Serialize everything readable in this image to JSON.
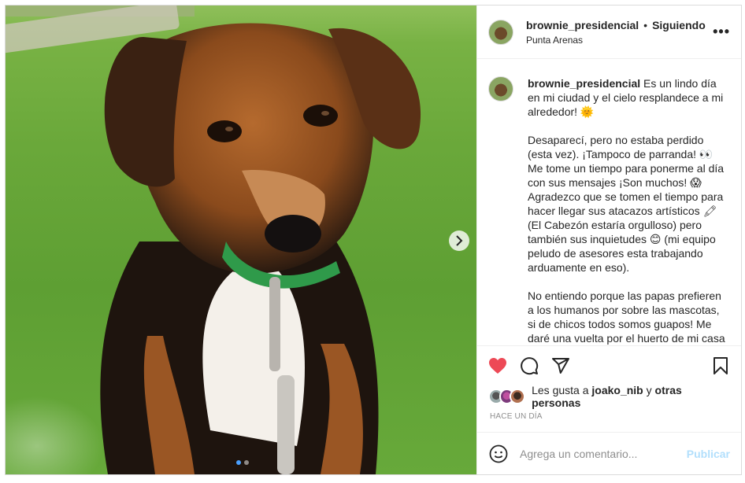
{
  "post": {
    "username": "brownie_presidencial",
    "follow_status": "Siguiendo",
    "separator": "•",
    "location": "Punta Arenas",
    "more_glyph": "•••"
  },
  "caption": {
    "username": "brownie_presidencial",
    "text": " Es un lindo día en mi ciudad y el cielo resplandece a mi alrededor! 🌞\n\nDesaparecí, pero no estaba perdido (esta vez). ¡Tampoco de parranda! 👀 Me tome un tiempo para ponerme al día con sus mensajes ¡Son muchos! 😱 Agradezco que se tomen el tiempo para hacer llegar sus atacazos artísticos 🖍 (El Cabezón estaría orgulloso) pero también sus inquietudes 😊 (mi equipo peludo de asesores esta trabajando arduamente en eso).\n\nNo entiendo porque las papas prefieren a los humanos por sobre las mascotas, si de chicos todos somos guapos! Me daré una vuelta por el huerto de mi casa para"
  },
  "likes": {
    "prefix": "Les gusta a ",
    "user": "joako_nib",
    "middle": " y ",
    "others": "otras personas"
  },
  "timestamp": "HACE UN DÍA",
  "comment_box": {
    "placeholder": "Agrega un comentario...",
    "publish_label": "Publicar"
  },
  "carousel": {
    "current": 1,
    "total": 2
  },
  "colors": {
    "like_red": "#ed4956",
    "publish_disabled": "#b2dffc",
    "carousel_active": "#4aa0ff"
  },
  "icons": [
    "heart-icon",
    "comment-icon",
    "share-icon",
    "bookmark-icon",
    "emoji-icon",
    "chevron-right-icon",
    "more-options-icon"
  ]
}
